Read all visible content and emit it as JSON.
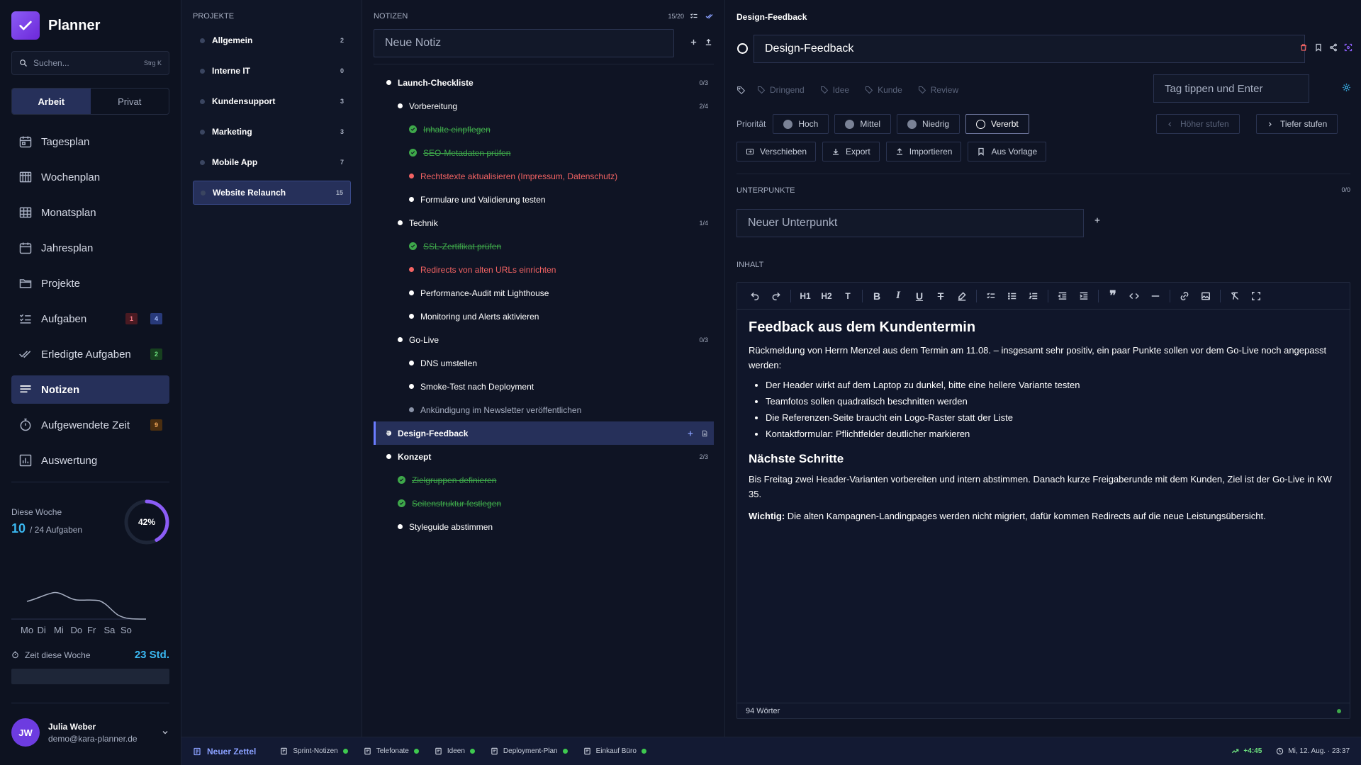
{
  "app": {
    "name": "Planner"
  },
  "search": {
    "placeholder": "Suchen...",
    "shortcut": "Strg K"
  },
  "workspace": {
    "tabs": [
      "Arbeit",
      "Privat"
    ],
    "active": "Arbeit"
  },
  "nav": [
    {
      "label": "Tagesplan",
      "icon": "calendar-day-icon"
    },
    {
      "label": "Wochenplan",
      "icon": "calendar-week-icon"
    },
    {
      "label": "Monatsplan",
      "icon": "calendar-grid-icon"
    },
    {
      "label": "Jahresplan",
      "icon": "calendar-year-icon"
    },
    {
      "label": "Projekte",
      "icon": "folder-icon"
    },
    {
      "label": "Aufgaben",
      "icon": "tasks-icon",
      "badges": [
        "1",
        "4"
      ]
    },
    {
      "label": "Erledigte Aufgaben",
      "icon": "double-check-icon",
      "badges": [
        "2"
      ]
    },
    {
      "label": "Notizen",
      "icon": "notes-icon",
      "active": true
    },
    {
      "label": "Aufgewendete Zeit",
      "icon": "stopwatch-icon",
      "badges": [
        "9"
      ]
    },
    {
      "label": "Auswertung",
      "icon": "chart-icon"
    }
  ],
  "week": {
    "label": "Diese Woche",
    "done": "10",
    "total": "/ 24 Aufgaben",
    "percent_label": "42%",
    "percent": 0.42,
    "days": [
      "Mo",
      "Di",
      "Mi",
      "Do",
      "Fr",
      "Sa",
      "So"
    ],
    "time_label": "Zeit diese Woche",
    "time_value": "23 Std."
  },
  "user": {
    "initials": "JW",
    "name": "Julia Weber",
    "email": "demo@kara-planner.de"
  },
  "projects": {
    "title": "PROJEKTE",
    "items": [
      {
        "name": "Allgemein",
        "count": "2"
      },
      {
        "name": "Interne IT",
        "count": "0"
      },
      {
        "name": "Kundensupport",
        "count": "3"
      },
      {
        "name": "Marketing",
        "count": "3"
      },
      {
        "name": "Mobile App",
        "count": "7"
      },
      {
        "name": "Website Relaunch",
        "count": "15",
        "active": true
      }
    ]
  },
  "notes": {
    "title": "NOTIZEN",
    "count": "15/20",
    "new_placeholder": "Neue Notiz",
    "tree": [
      {
        "text": "Launch-Checkliste",
        "level": 0,
        "style": "bold",
        "count": "0/3"
      },
      {
        "text": "Vorbereitung",
        "level": 1,
        "style": "normal",
        "count": "2/4"
      },
      {
        "text": "Inhalte einpflegen",
        "level": 2,
        "style": "done"
      },
      {
        "text": "SEO-Metadaten prüfen",
        "level": 2,
        "style": "done"
      },
      {
        "text": "Rechtstexte aktualisieren (Impressum, Datenschutz)",
        "level": 2,
        "style": "urgent"
      },
      {
        "text": "Formulare und Validierung testen",
        "level": 2,
        "style": "normal"
      },
      {
        "text": "Technik",
        "level": 1,
        "style": "normal",
        "count": "1/4"
      },
      {
        "text": "SSL-Zertifikat prüfen",
        "level": 2,
        "style": "done"
      },
      {
        "text": "Redirects von alten URLs einrichten",
        "level": 2,
        "style": "urgent"
      },
      {
        "text": "Performance-Audit mit Lighthouse",
        "level": 2,
        "style": "normal"
      },
      {
        "text": "Monitoring und Alerts aktivieren",
        "level": 2,
        "style": "normal"
      },
      {
        "text": "Go-Live",
        "level": 1,
        "style": "normal",
        "count": "0/3"
      },
      {
        "text": "DNS umstellen",
        "level": 2,
        "style": "normal"
      },
      {
        "text": "Smoke-Test nach Deployment",
        "level": 2,
        "style": "normal"
      },
      {
        "text": "Ankündigung im Newsletter veröffentlichen",
        "level": 2,
        "style": "muted"
      },
      {
        "text": "Design-Feedback",
        "level": 0,
        "style": "selected"
      },
      {
        "text": "Konzept",
        "level": 0,
        "style": "bold",
        "count": "2/3"
      },
      {
        "text": "Zielgruppen definieren",
        "level": 1,
        "style": "done"
      },
      {
        "text": "Seitenstruktur festlegen",
        "level": 1,
        "style": "done"
      },
      {
        "text": "Styleguide abstimmen",
        "level": 1,
        "style": "normal"
      }
    ]
  },
  "detail": {
    "header": "Design-Feedback",
    "title": "Design-Feedback",
    "tags": [
      "Dringend",
      "Idee",
      "Kunde",
      "Review"
    ],
    "tag_placeholder": "Tag tippen und Enter",
    "priority_label": "Priorität",
    "priorities": [
      "Hoch",
      "Mittel",
      "Niedrig",
      "Vererbt"
    ],
    "priority_active": "Vererbt",
    "level_up": "Höher stufen",
    "level_down": "Tiefer stufen",
    "actions": [
      "Verschieben",
      "Export",
      "Importieren",
      "Aus Vorlage"
    ],
    "sub_label": "UNTERPUNKTE",
    "sub_count": "0/0",
    "sub_placeholder": "Neuer Unterpunkt",
    "content_label": "INHALT",
    "doc": {
      "h1": "Feedback aus dem Kundentermin",
      "intro": "Rückmeldung von Herrn Menzel aus dem Termin am 11.08. – insgesamt sehr positiv, ein paar Punkte sollen vor dem Go-Live noch angepasst werden:",
      "bullets": [
        "Der Header wirkt auf dem Laptop zu dunkel, bitte eine hellere Variante testen",
        "Teamfotos sollen quadratisch beschnitten werden",
        "Die Referenzen-Seite braucht ein Logo-Raster statt der Liste",
        "Kontaktformular: Pflichtfelder deutlicher markieren"
      ],
      "h2": "Nächste Schritte",
      "p2": "Bis Freitag zwei Header-Varianten vorbereiten und intern abstimmen. Danach kurze Freigaberunde mit dem Kunden, Ziel ist der Go-Live in KW 35.",
      "important_label": "Wichtig:",
      "important_text": " Die alten Kampagnen-Landingpages werden nicht migriert, dafür kommen Redirects auf die neue Leistungsübersicht."
    },
    "word_count": "94 Wörter"
  },
  "bottom": {
    "new_sheet": "Neuer Zettel",
    "sheets": [
      "Sprint-Notizen",
      "Telefonate",
      "Ideen",
      "Deployment-Plan",
      "Einkauf Büro"
    ],
    "time_delta": "+4:45",
    "datetime": "Mi, 12. Aug. · 23:37"
  },
  "colors": {
    "accent": "#26305a",
    "brand": "#7c3aed",
    "done": "#3ea84a",
    "urgent": "#f36363",
    "info": "#3ab7f0"
  }
}
